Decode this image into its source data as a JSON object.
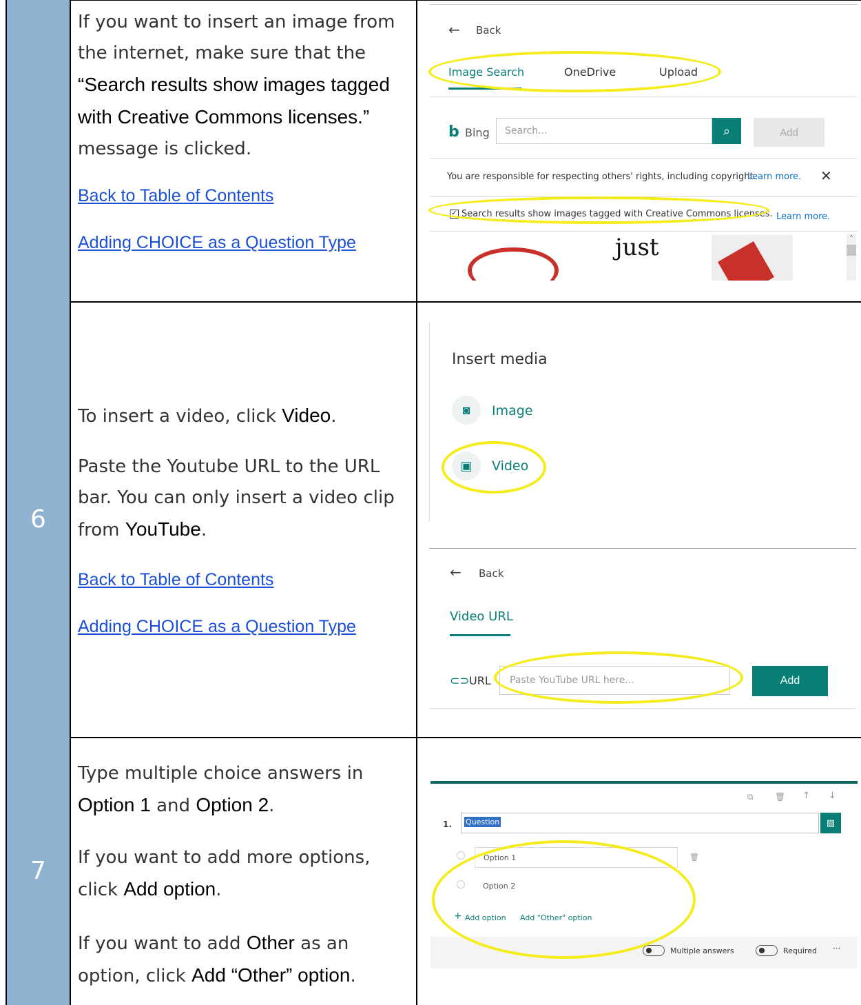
{
  "row5": {
    "number": "",
    "para_a": "If you want to insert an image from the internet, make sure that the",
    "para_b": "“Search results show images tagged with Creative Commons licenses.”",
    "para_c": "message is clicked.",
    "link1": "Back to Table of Contents",
    "link2": "Adding CHOICE as a Question Type",
    "shot": {
      "back": "Back",
      "tabs": [
        "Image Search",
        "OneDrive",
        "Upload"
      ],
      "bing": "Bing",
      "search_placeholder": "Search...",
      "add": "Add",
      "notice": "You are responsible for respecting others' rights, including copyright.",
      "learn_more": "Learn more.",
      "cc_text": "Search results show images tagged with Creative Commons licenses.",
      "cc_learn": "Learn more.",
      "thumb_text": "just"
    }
  },
  "row6": {
    "number": "6",
    "p1_a": "To insert a video, click ",
    "p1_b": "Video",
    "p1_c": ".",
    "p2_a": "Paste the Youtube URL to the URL bar. You can only insert a video clip from ",
    "p2_b": "YouTube",
    "p2_c": ".",
    "link1": "Back to Table of Contents",
    "link2": "Adding CHOICE as a Question Type",
    "shot1": {
      "title": "Insert media",
      "image": "Image",
      "video": "Video"
    },
    "shot2": {
      "back": "Back",
      "tab": "Video URL",
      "url_label": "URL",
      "placeholder": "Paste YouTube URL here...",
      "add": "Add"
    }
  },
  "row7": {
    "number": "7",
    "p1_a": "Type multiple choice answers in ",
    "p1_b": "Option 1",
    "p1_c": " and ",
    "p1_d": "Option 2",
    "p1_e": ".",
    "p2_a": "If you want to add more options, click ",
    "p2_b": "Add option",
    "p2_c": ".",
    "p3_a": "If you want to add ",
    "p3_b": "Other",
    "p3_c": " as an option, click ",
    "p3_d": "Add “Other” option",
    "p3_e": ".",
    "shot": {
      "qnum": "1.",
      "question": "Question",
      "option1": "Option 1",
      "option2": "Option 2",
      "add_option": "Add option",
      "add_other": "Add \"Other\" option",
      "multiple": "Multiple answers",
      "required": "Required",
      "more": "···"
    }
  }
}
